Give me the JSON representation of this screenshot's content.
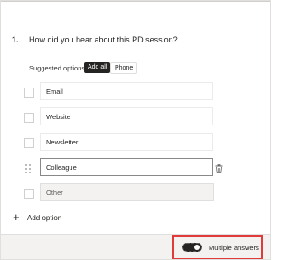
{
  "question": {
    "number": "1.",
    "text": "How did you hear about this PD session?"
  },
  "suggested": {
    "label": "Suggested options:",
    "add_all": "Add all",
    "chip": "Phone"
  },
  "options": [
    {
      "label": "Email"
    },
    {
      "label": "Website"
    },
    {
      "label": "Newsletter"
    },
    {
      "label": "Colleague"
    },
    {
      "label": "Other"
    }
  ],
  "add_option": "Add option",
  "footer": {
    "multiple_answers_label": "Multiple answers",
    "multiple_answers_on": true
  },
  "colors": {
    "highlight": "#e03a3a",
    "toggle_on": "#252423"
  },
  "icons": [
    "drag-handle-icon",
    "trash-icon",
    "plus-icon"
  ]
}
